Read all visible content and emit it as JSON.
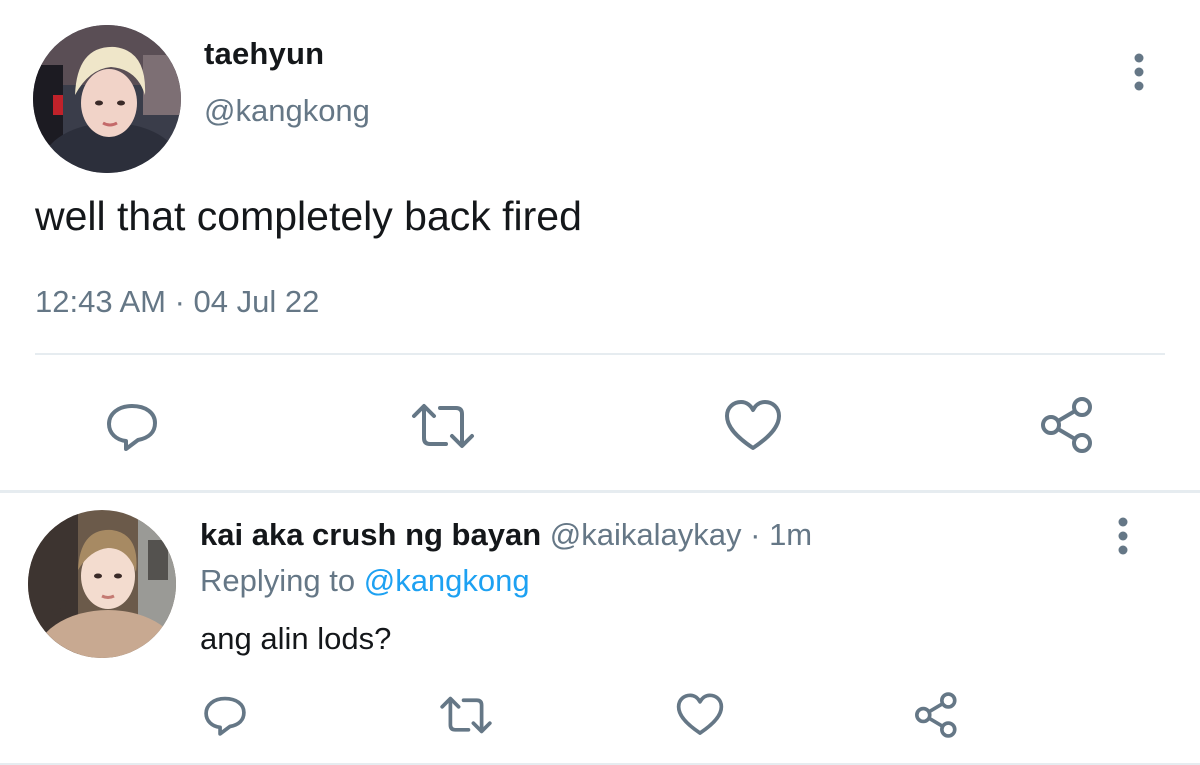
{
  "main_tweet": {
    "display_name": "taehyun",
    "handle": "@kangkong",
    "text": "well that completely back fired",
    "time": "12:43 AM",
    "separator": " · ",
    "date": "04 Jul 22",
    "actions": [
      "reply-icon",
      "retweet-icon",
      "like-icon",
      "share-icon"
    ],
    "more_icon": "more-vertical-icon"
  },
  "reply_tweet": {
    "display_name": "kai aka crush ng bayan",
    "handle": "@kaikalaykay",
    "dot": " · ",
    "time": "1m",
    "replying_label": "Replying to ",
    "replying_to": "@kangkong",
    "text": "ang alin lods?",
    "actions": [
      "reply-icon",
      "retweet-icon",
      "like-icon",
      "share-icon"
    ],
    "more_icon": "more-vertical-icon"
  },
  "colors": {
    "text_primary": "#14171a",
    "text_secondary": "#657786",
    "link": "#1da1f2",
    "icon": "#657786",
    "divider": "#e6ecf0",
    "background": "#ffffff"
  }
}
